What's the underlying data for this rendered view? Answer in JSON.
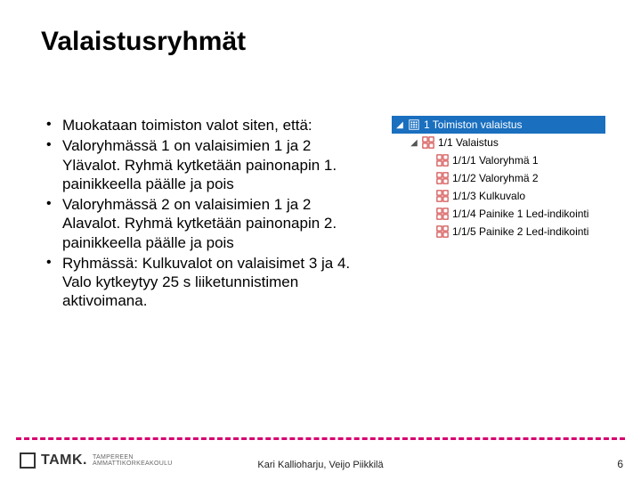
{
  "title": "Valaistusryhmät",
  "bullets": [
    "Muokataan toimiston valot siten, että:",
    "Valoryhmässä 1 on valaisimien 1 ja 2 Ylävalot. Ryhmä kytketään painonapin 1. painikkeella päälle ja pois",
    "Valoryhmässä 2 on valaisimien 1 ja 2 Alavalot. Ryhmä kytketään painonapin 2. painikkeella päälle ja pois",
    " Ryhmässä: Kulkuvalot on valaisimet 3 ja 4. Valo kytkeytyy 25 s liiketunnistimen aktivoimana."
  ],
  "tree": {
    "root": {
      "label": "1 Toimiston valaistus"
    },
    "group": {
      "label": "1/1 Valaistus"
    },
    "items": [
      {
        "label": "1/1/1 Valoryhmä 1"
      },
      {
        "label": "1/1/2 Valoryhmä 2"
      },
      {
        "label": "1/1/3 Kulkuvalo"
      },
      {
        "label": "1/1/4 Painike 1 Led-indikointi"
      },
      {
        "label": "1/1/5 Painike 2 Led-indikointi"
      }
    ]
  },
  "footer": {
    "logo_text": "TAMK.",
    "logo_sub1": "TAMPEREEN",
    "logo_sub2": "AMMATTIKORKEAKOULU",
    "authors": "Kari Kallioharju, Veijo Piikkilä",
    "page": "6"
  },
  "colors": {
    "accent": "#d6006f",
    "tree_sel": "#1a6fbf"
  }
}
